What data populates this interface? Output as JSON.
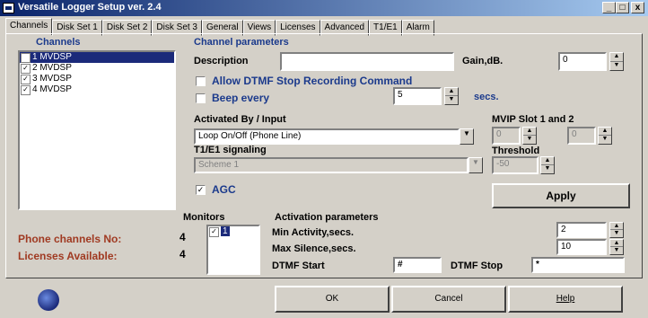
{
  "window": {
    "title": "Versatile Logger Setup ver. 2.4",
    "minimize_label": "_",
    "maximize_label": "□",
    "close_label": "x"
  },
  "tabs": [
    "Channels",
    "Disk Set 1",
    "Disk Set 2",
    "Disk Set 3",
    "General",
    "Views",
    "Licenses",
    "Advanced",
    "T1/E1",
    "Alarm"
  ],
  "channels": {
    "title": "Channels",
    "items": [
      "1 MVDSP",
      "2 MVDSP",
      "3 MVDSP",
      "4 MVDSP"
    ]
  },
  "params": {
    "title": "Channel parameters",
    "description_label": "Description",
    "description_value": "",
    "gain_label": "Gain,dB.",
    "gain_value": "0",
    "allow_dtmf_label": "Allow DTMF Stop Recording Command",
    "beep_label": "Beep every",
    "beep_value": "5",
    "secs_label": "secs.",
    "activated_label": "Activated By / Input",
    "activated_value": "Loop On/Off (Phone Line)",
    "mvip_label": "MVIP Slot 1 and 2",
    "mvip_slot1": "0",
    "mvip_slot2": "0",
    "t1e1_label": "T1/E1 signaling",
    "t1e1_value": "Scheme 1",
    "threshold_label": "Threshold",
    "threshold_value": "-50",
    "agc_label": "AGC",
    "apply_label": "Apply"
  },
  "counts": {
    "phone_label": "Phone channels No:",
    "phone_value": "4",
    "licenses_label": "Licenses Available:",
    "licenses_value": "4"
  },
  "monitors": {
    "title": "Monitors",
    "item": "1"
  },
  "activation": {
    "title": "Activation parameters",
    "min_activity_label": "Min Activity,secs.",
    "min_activity_value": "2",
    "max_silence_label": "Max Silence,secs.",
    "max_silence_value": "10",
    "dtmf_start_label": "DTMF Start",
    "dtmf_start_value": "#",
    "dtmf_stop_label": "DTMF Stop",
    "dtmf_stop_value": "*"
  },
  "buttons": {
    "ok": "OK",
    "cancel": "Cancel",
    "help": "Help"
  },
  "colors": {
    "title_start": "#0a246a",
    "title_end": "#a6caf0",
    "accent_blue": "#1b3a8c",
    "accent_red": "#a03a22"
  }
}
